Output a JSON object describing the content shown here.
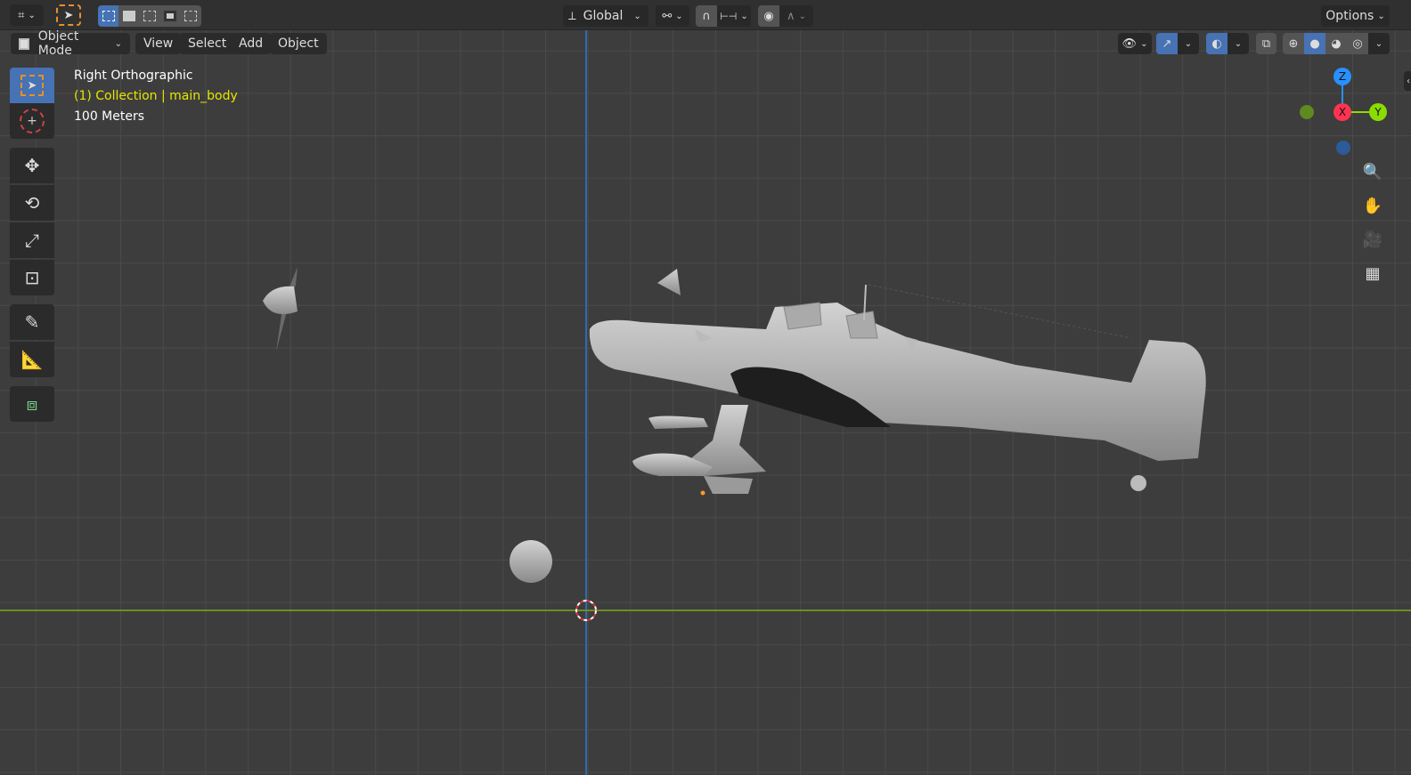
{
  "header": {
    "options_label": "Options",
    "transform_orientation": "Global"
  },
  "menu": {
    "mode": "Object Mode",
    "items": [
      "View",
      "Select",
      "Add",
      "Object"
    ]
  },
  "overlay": {
    "view_name": "Right Orthographic",
    "collection": "(1) Collection | main_body",
    "scale": "100 Meters"
  },
  "gizmo": {
    "x": "X",
    "y": "Y",
    "z": "Z"
  },
  "colors": {
    "accent": "#4772b3",
    "x_axis": "#ff3352",
    "y_axis": "#8bdc00",
    "z_axis": "#2890ff",
    "overlay_yellow": "#e6e600"
  },
  "toolbar": {
    "tools": [
      "select-box",
      "cursor",
      "move",
      "rotate",
      "scale",
      "transform",
      "annotate",
      "measure",
      "add-cube"
    ]
  }
}
